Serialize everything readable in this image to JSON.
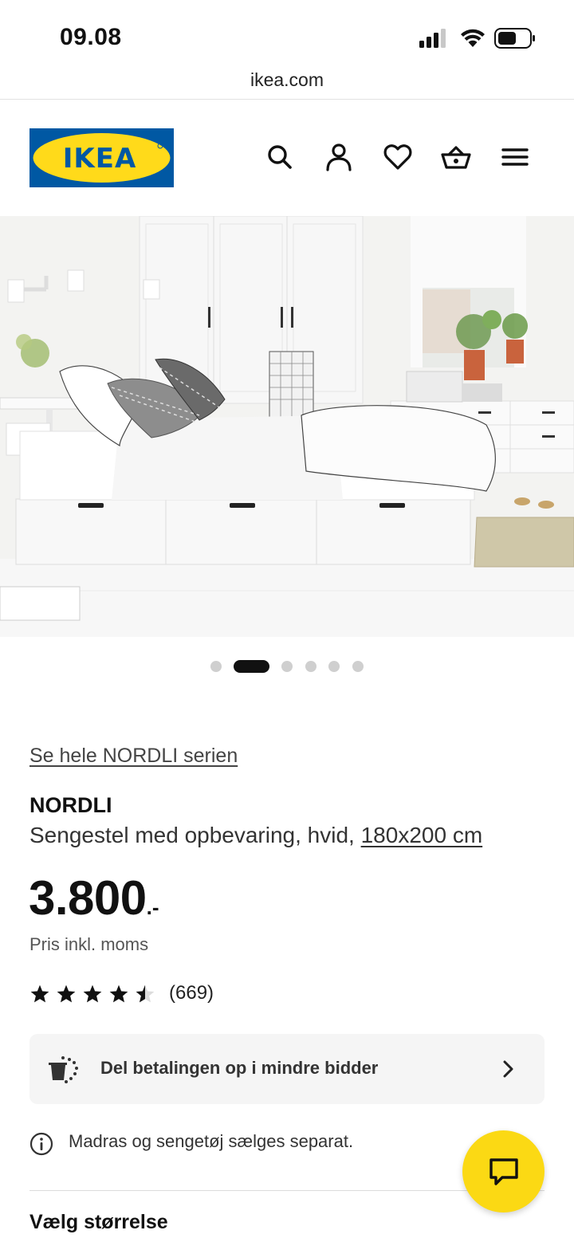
{
  "status_bar": {
    "time": "09.08"
  },
  "browser": {
    "url": "ikea.com"
  },
  "header": {
    "logo_text": "IKEA",
    "brand_colors": {
      "blue": "#0058a3",
      "yellow": "#ffda1a"
    },
    "icons": [
      "search-icon",
      "account-icon",
      "heart-icon",
      "cart-icon",
      "menu-icon"
    ]
  },
  "gallery": {
    "image_count": 6,
    "active_index": 1
  },
  "product": {
    "series_link": "Se hele NORDLI serien",
    "name": "NORDLI",
    "description": "Sengestel med opbevaring, hvid,",
    "size": "180x200 cm",
    "price": "3.800",
    "price_suffix": ".-",
    "vat_note": "Pris inkl. moms",
    "rating": 4.5,
    "review_count": "(669)"
  },
  "installment": {
    "label": "Del betalingen op i mindre bidder",
    "icon": "piggy-bank-icon"
  },
  "note": {
    "text": "Madras og sengetøj sælges separat.",
    "icon": "info-icon"
  },
  "size_section": {
    "heading": "Vælg størrelse"
  },
  "chat": {
    "icon": "chat-icon",
    "color": "#fbd914"
  }
}
